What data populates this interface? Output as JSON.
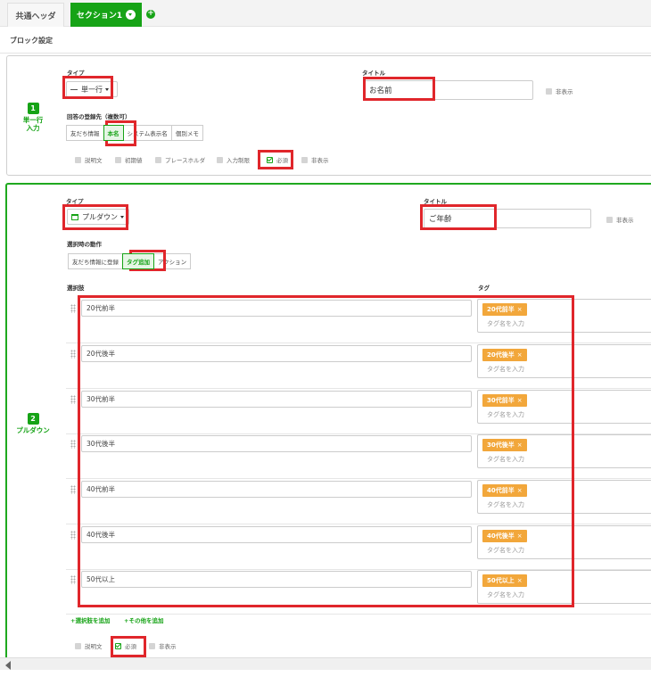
{
  "tabs": {
    "common": "共通ヘッダ",
    "section": "セクション1",
    "add": "+"
  },
  "block_settings_title": "ブロック設定",
  "block1": {
    "number": "1",
    "type_name_line1": "単一行",
    "type_name_line2": "入力",
    "type_label": "タイプ",
    "type_value": "単一行",
    "title_label": "タイトル",
    "title_value": "お名前",
    "hide_label": "非表示",
    "dest_label": "回答の登録先（複数可）",
    "dest_options": [
      "友だち情報",
      "本名",
      "システム表示名",
      "個別メモ"
    ],
    "dest_active": "本名",
    "options": [
      "説明文",
      "初期値",
      "プレースホルダ",
      "入力制限",
      "必須",
      "非表示"
    ],
    "checked": "必須"
  },
  "block2": {
    "number": "2",
    "type_name": "プルダウン",
    "type_label": "タイプ",
    "type_value": "プルダウン",
    "title_label": "タイトル",
    "title_value": "ご年齢",
    "hide_label": "非表示",
    "action_label": "選択時の動作",
    "actions": [
      "友だち情報に登録",
      "タグ追加",
      "アクション"
    ],
    "action_active": "タグ追加",
    "choices_label": "選択肢",
    "tag_label": "タグ",
    "tag_placeholder": "タグ名を入力",
    "choices": [
      {
        "label": "20代前半",
        "tag": "20代前半"
      },
      {
        "label": "20代後半",
        "tag": "20代後半"
      },
      {
        "label": "30代前半",
        "tag": "30代前半"
      },
      {
        "label": "30代後半",
        "tag": "30代後半"
      },
      {
        "label": "40代前半",
        "tag": "40代前半"
      },
      {
        "label": "40代後半",
        "tag": "40代後半"
      },
      {
        "label": "50代以上",
        "tag": "50代以上"
      }
    ],
    "add_choice": "+選択肢を追加",
    "add_other": "+その他を追加",
    "options": [
      "説明文",
      "必須",
      "非表示"
    ],
    "checked": "必須"
  },
  "colors": {
    "brand_green": "#16a316",
    "tag_orange": "#f2a73b",
    "highlight_red": "#e0262b"
  }
}
